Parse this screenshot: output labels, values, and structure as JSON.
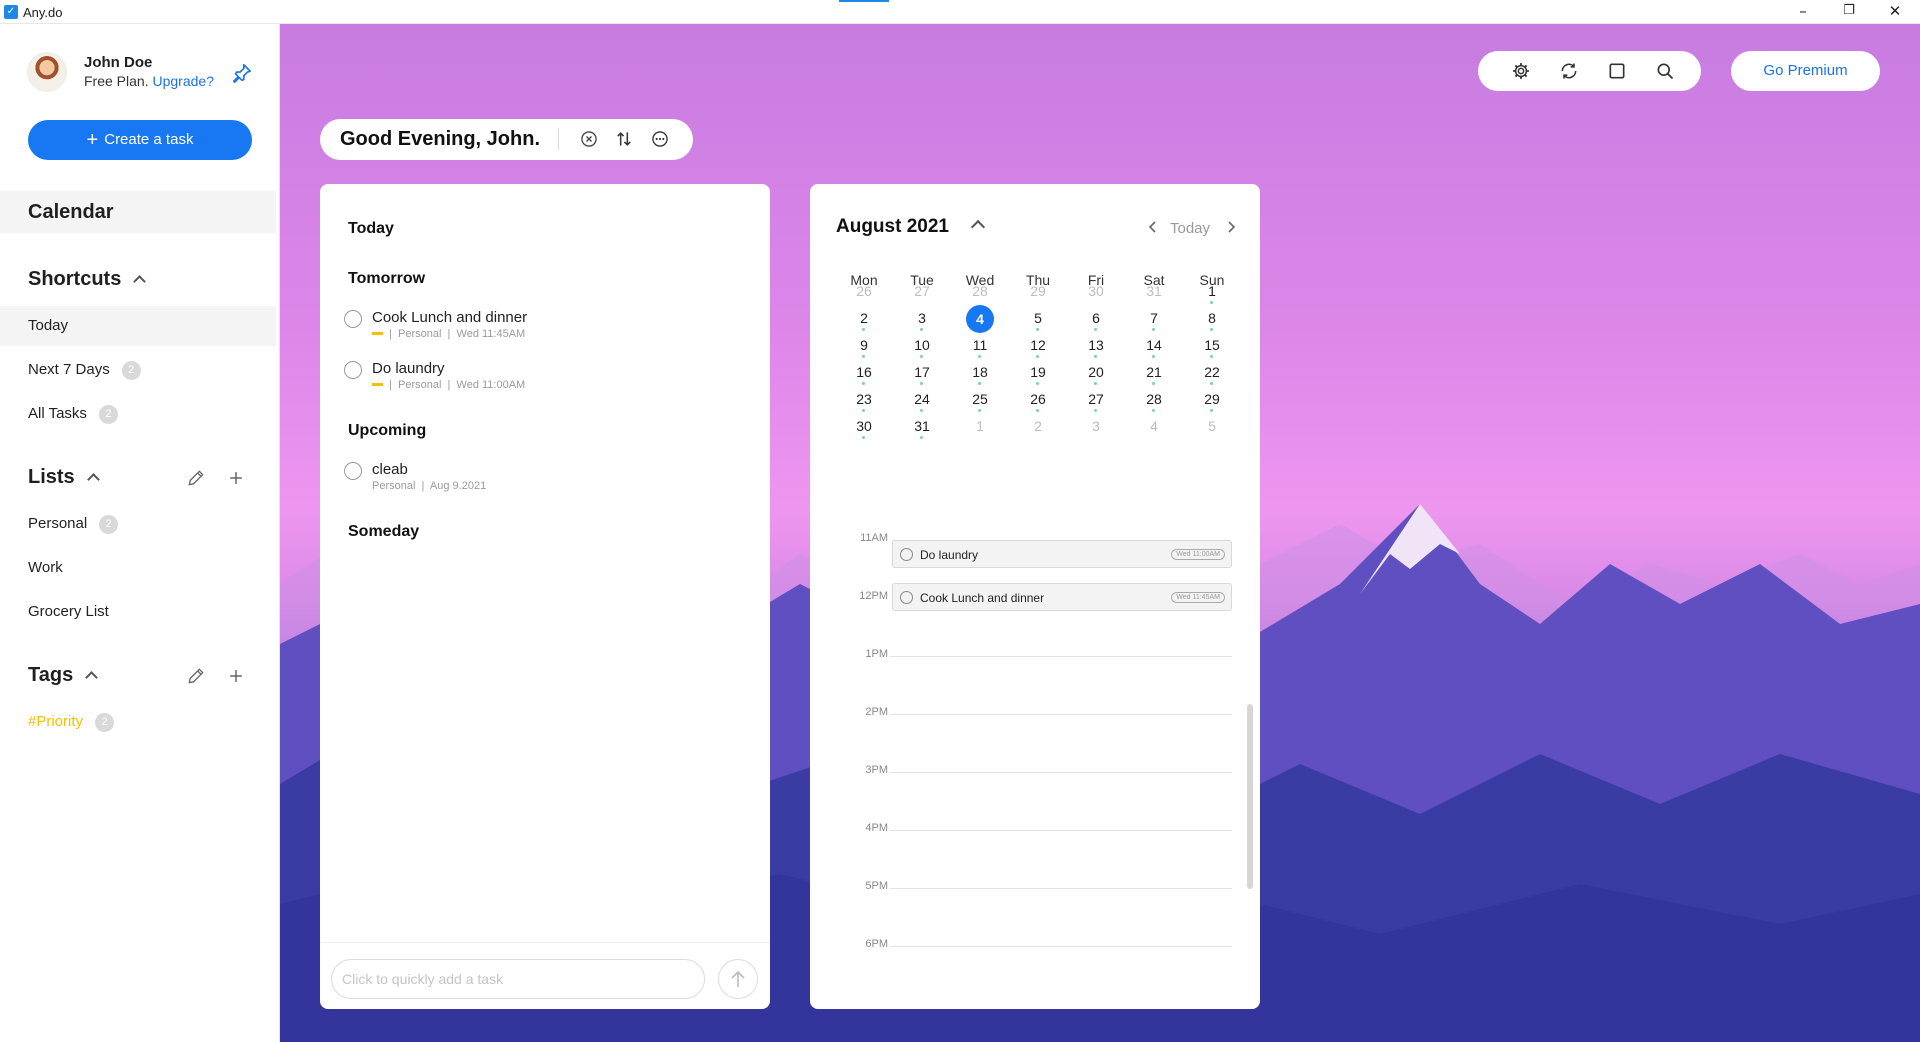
{
  "window": {
    "title": "Any.do",
    "icon": "anydo-check-icon",
    "minimize": "–",
    "restore": "❐",
    "close": "✕"
  },
  "user": {
    "name": "John Doe",
    "plan": "Free Plan.",
    "upgrade": "Upgrade?"
  },
  "sidebar": {
    "create_label": "Create a task",
    "calendar_label": "Calendar",
    "shortcuts_title": "Shortcuts",
    "shortcuts": [
      {
        "label": "Today",
        "count": ""
      },
      {
        "label": "Next 7 Days",
        "count": "2"
      },
      {
        "label": "All Tasks",
        "count": "2"
      }
    ],
    "lists_title": "Lists",
    "lists": [
      {
        "label": "Personal",
        "count": "2"
      },
      {
        "label": "Work",
        "count": ""
      },
      {
        "label": "Grocery List",
        "count": ""
      }
    ],
    "tags_title": "Tags",
    "tags": [
      {
        "label": "#Priority",
        "count": "2",
        "color": "#f2c200"
      }
    ]
  },
  "toolbar": {
    "premium_label": "Go Premium",
    "icons": [
      "settings-icon",
      "sync-icon",
      "focus-square-icon",
      "search-icon"
    ]
  },
  "greeting": {
    "text": "Good Evening, John."
  },
  "tasks": {
    "groups": {
      "today": "Today",
      "tomorrow": "Tomorrow",
      "upcoming": "Upcoming",
      "someday": "Someday"
    },
    "tomorrow": [
      {
        "title": "Cook Lunch and dinner",
        "list": "Personal",
        "sep": "|",
        "time": "Wed 11:45AM"
      },
      {
        "title": "Do laundry",
        "list": "Personal",
        "sep": "|",
        "time": "Wed 11:00AM"
      }
    ],
    "upcoming": [
      {
        "title": "cleab",
        "list": "Personal",
        "sep": "|",
        "time": "Aug 9.2021"
      }
    ],
    "quick_add_placeholder": "Click to quickly add a task"
  },
  "calendar": {
    "month": "August 2021",
    "today_label": "Today",
    "weekdays": [
      "Mon",
      "Tue",
      "Wed",
      "Thu",
      "Fri",
      "Sat",
      "Sun"
    ],
    "weeks": [
      [
        "26",
        "27",
        "28",
        "29",
        "30",
        "31",
        "1"
      ],
      [
        "2",
        "3",
        "4",
        "5",
        "6",
        "7",
        "8"
      ],
      [
        "9",
        "10",
        "11",
        "12",
        "13",
        "14",
        "15"
      ],
      [
        "16",
        "17",
        "18",
        "19",
        "20",
        "21",
        "22"
      ],
      [
        "23",
        "24",
        "25",
        "26",
        "27",
        "28",
        "29"
      ],
      [
        "30",
        "31",
        "1",
        "2",
        "3",
        "4",
        "5"
      ]
    ],
    "selected": "4",
    "hours": [
      "11AM",
      "12PM",
      "1PM",
      "2PM",
      "3PM",
      "4PM",
      "5PM",
      "6PM"
    ],
    "events": [
      {
        "title": "Do laundry",
        "time": "Wed 11:00AM"
      },
      {
        "title": "Cook Lunch and dinner",
        "time": "Wed 11:45AM"
      }
    ]
  },
  "colors": {
    "accent": "#1877f2",
    "tag": "#f2c200"
  }
}
